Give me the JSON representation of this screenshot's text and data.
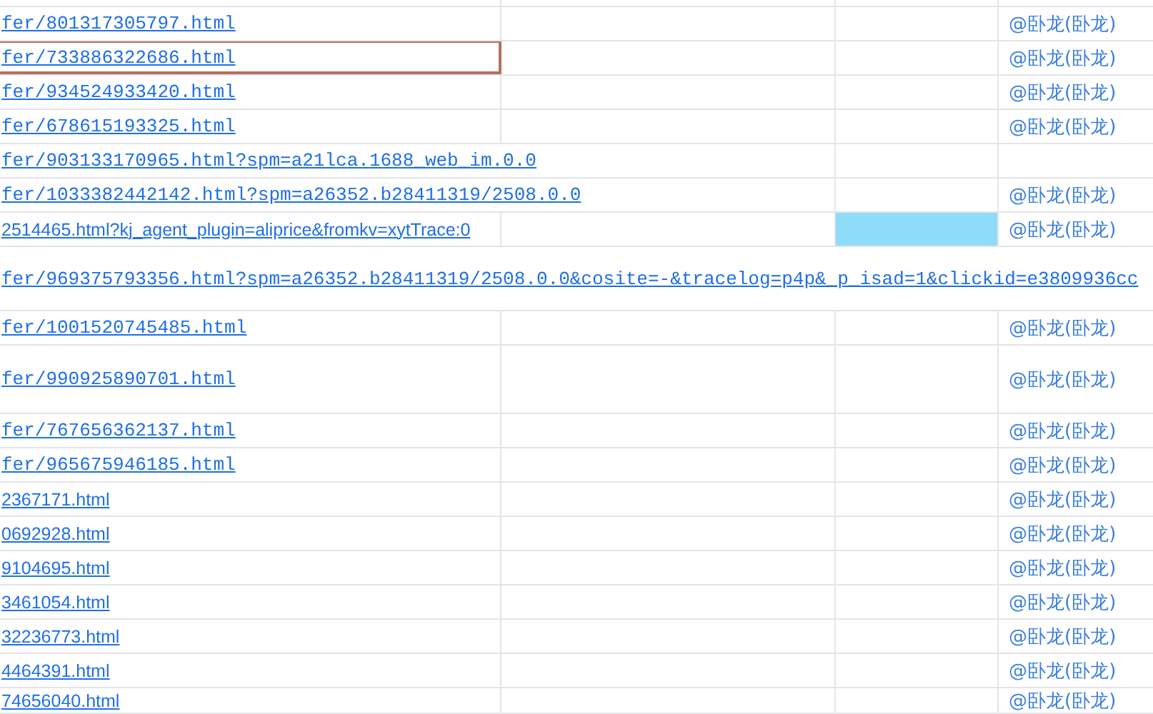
{
  "sheet": {
    "rows": [
      {
        "kind": "partial",
        "selected": false,
        "highlight": false
      },
      {
        "kind": "mono",
        "link": "fer/801317305797.html",
        "user": "@卧龙(卧龙)",
        "selected": false,
        "highlight": false
      },
      {
        "kind": "mono",
        "link": "fer/733886322686.html",
        "user": "@卧龙(卧龙)",
        "selected": true,
        "highlight": false
      },
      {
        "kind": "mono",
        "link": "fer/934524933420.html",
        "user": "@卧龙(卧龙)",
        "selected": false,
        "highlight": false
      },
      {
        "kind": "mono",
        "link": "fer/678615193325.html",
        "user": "@卧龙(卧龙)",
        "selected": false,
        "highlight": false
      },
      {
        "kind": "mono-overflow",
        "link": "fer/903133170965.html?spm=a21lca.1688_web_im.0.0",
        "selected": false,
        "highlight": false
      },
      {
        "kind": "mono-overflow",
        "link": "fer/1033382442142.html?spm=a26352.b28411319/2508.0.0",
        "user": "@卧龙(卧龙)",
        "selected": false,
        "highlight": false
      },
      {
        "kind": "sans",
        "link": "2514465.html?kj_agent_plugin=aliprice&fromkv=xytTrace:0",
        "user": "@卧龙(卧龙)",
        "selected": false,
        "highlight": true
      },
      {
        "kind": "mono-wide",
        "link": "fer/969375793356.html?spm=a26352.b28411319/2508.0.0&cosite=-&tracelog=p4p&_p_isad=1&clickid=e3809936cc",
        "selected": false,
        "highlight": false
      },
      {
        "kind": "mono",
        "link": "fer/1001520745485.html",
        "user": "@卧龙(卧龙)",
        "selected": false,
        "highlight": false
      },
      {
        "kind": "mono-tall",
        "link": "fer/990925890701.html",
        "user": "@卧龙(卧龙)",
        "selected": false,
        "highlight": false
      },
      {
        "kind": "mono",
        "link": "fer/767656362137.html",
        "user": "@卧龙(卧龙)",
        "selected": false,
        "highlight": false
      },
      {
        "kind": "mono",
        "link": "fer/965675946185.html",
        "user": "@卧龙(卧龙)",
        "selected": false,
        "highlight": false
      },
      {
        "kind": "sans",
        "link": "2367171.html",
        "user": "@卧龙(卧龙)",
        "selected": false,
        "highlight": false
      },
      {
        "kind": "sans",
        "link": "0692928.html",
        "user": "@卧龙(卧龙)",
        "selected": false,
        "highlight": false
      },
      {
        "kind": "sans",
        "link": "9104695.html",
        "user": "@卧龙(卧龙)",
        "selected": false,
        "highlight": false
      },
      {
        "kind": "sans",
        "link": "3461054.html",
        "user": "@卧龙(卧龙)",
        "selected": false,
        "highlight": false
      },
      {
        "kind": "sans",
        "link": "32236773.html",
        "user": "@卧龙(卧龙)",
        "selected": false,
        "highlight": false
      },
      {
        "kind": "sans",
        "link": "4464391.html",
        "user": "@卧龙(卧龙)",
        "selected": false,
        "highlight": false
      },
      {
        "kind": "sans",
        "link": "74656040.html",
        "user": "@卧龙(卧龙)",
        "selected": false,
        "highlight": false
      }
    ]
  }
}
